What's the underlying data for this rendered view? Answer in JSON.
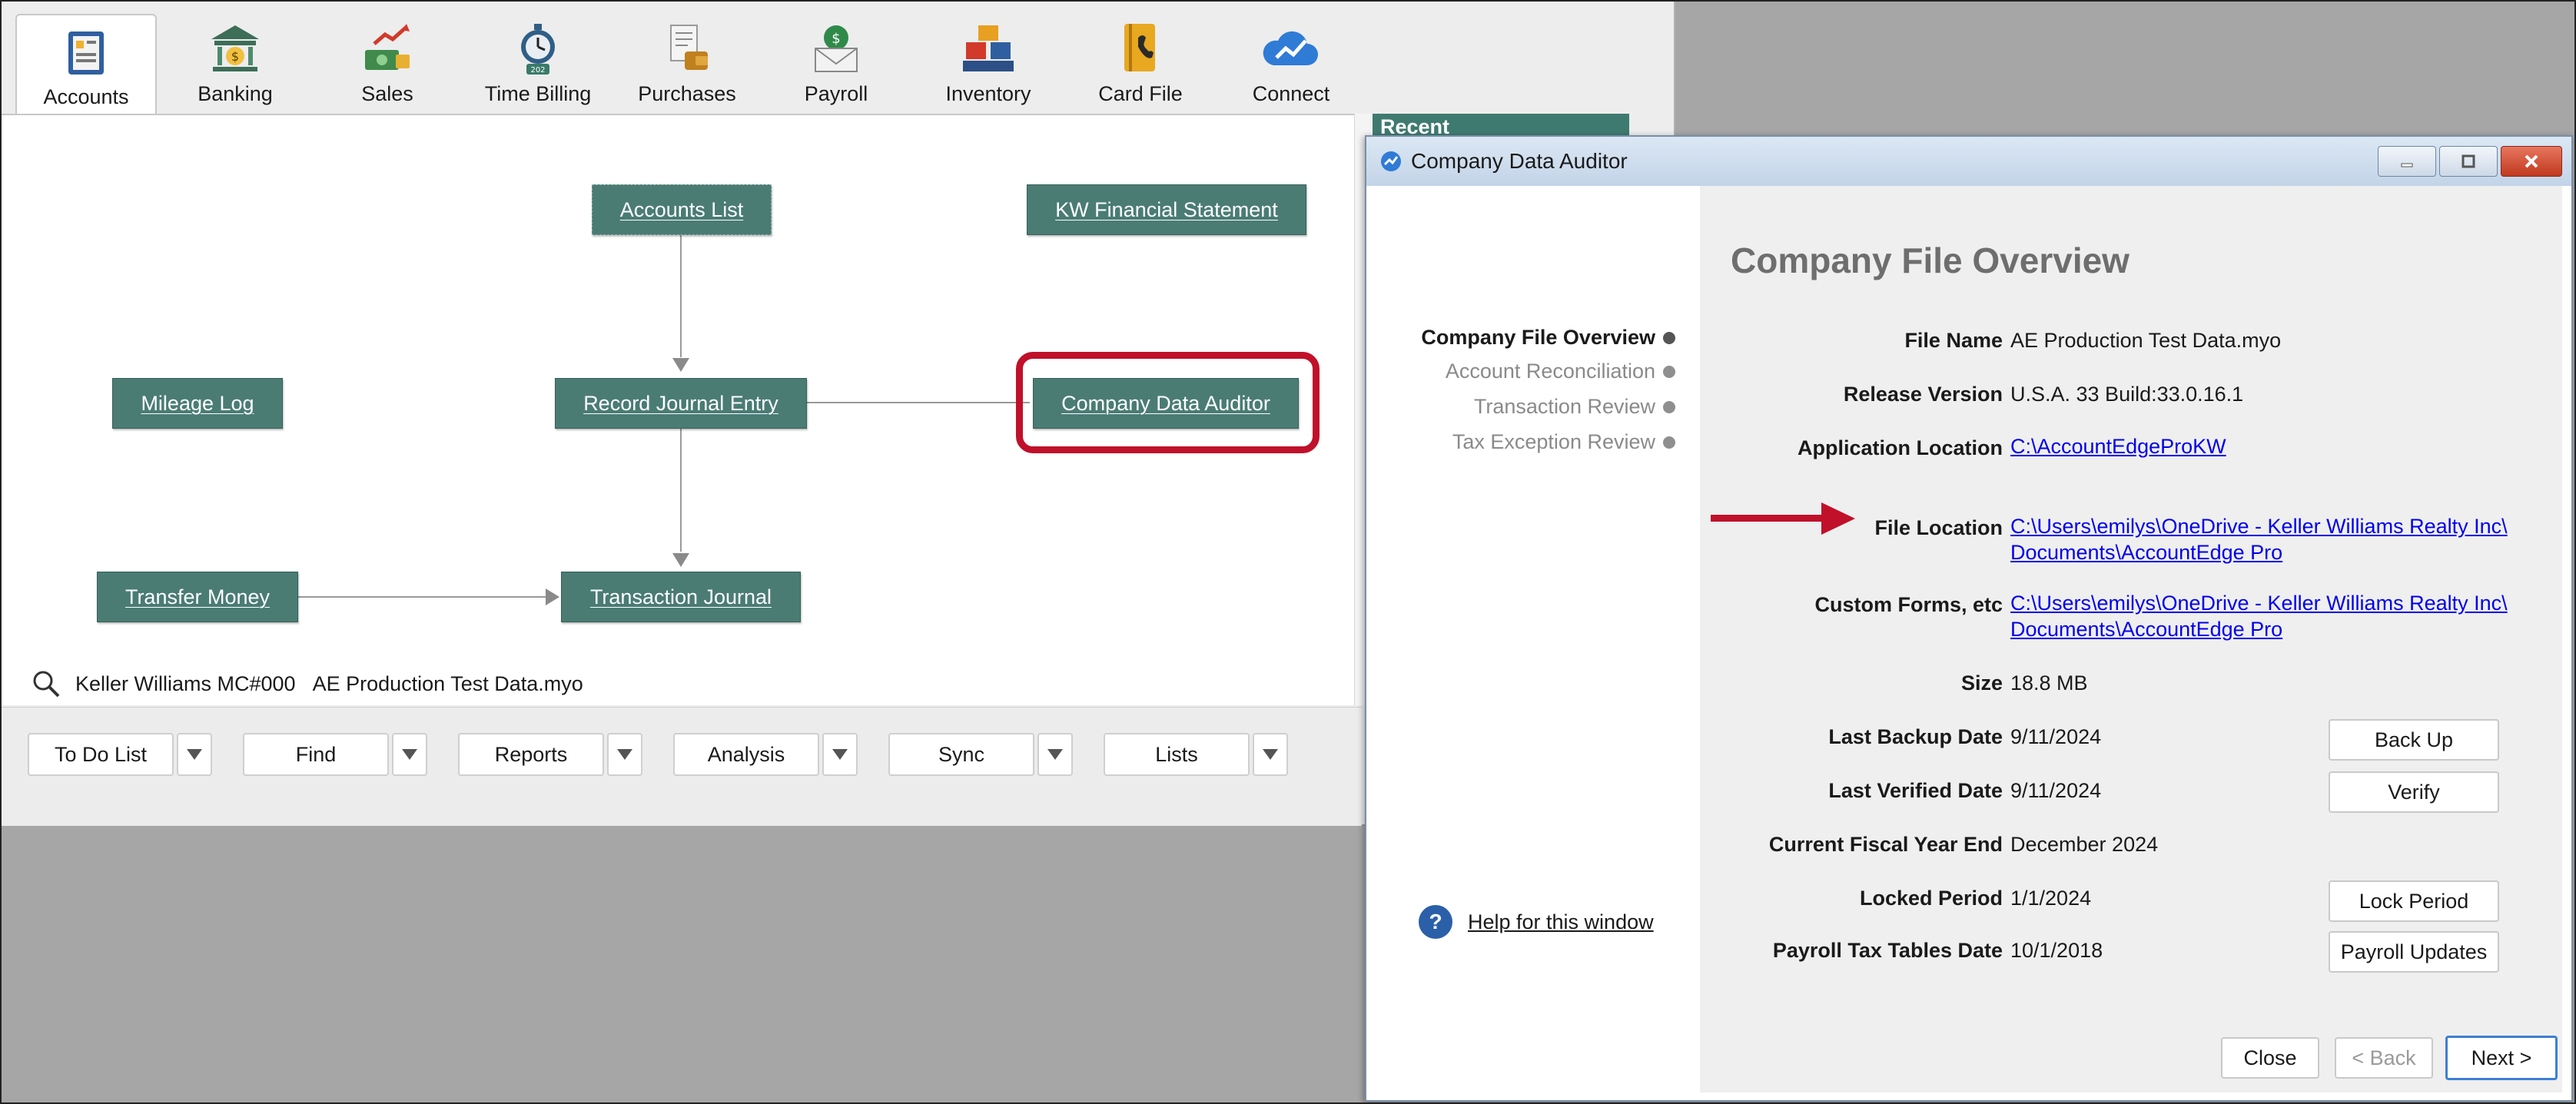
{
  "tabs": [
    {
      "label": "Accounts",
      "icon": "accounts-book-icon",
      "active": true
    },
    {
      "label": "Banking",
      "icon": "bank-icon",
      "active": false
    },
    {
      "label": "Sales",
      "icon": "sales-icon",
      "active": false
    },
    {
      "label": "Time Billing",
      "icon": "stopwatch-icon",
      "active": false
    },
    {
      "label": "Purchases",
      "icon": "purchases-icon",
      "active": false
    },
    {
      "label": "Payroll",
      "icon": "payroll-envelope-icon",
      "active": false
    },
    {
      "label": "Inventory",
      "icon": "inventory-boxes-icon",
      "active": false
    },
    {
      "label": "Card File",
      "icon": "card-file-icon",
      "active": false
    },
    {
      "label": "Connect",
      "icon": "cloud-connect-icon",
      "active": false
    }
  ],
  "flow": {
    "accounts_list": "Accounts List",
    "kw_financial": "KW Financial Statement",
    "mileage_log": "Mileage Log",
    "record_journal": "Record Journal Entry",
    "company_auditor": "Company Data Auditor",
    "transfer_money": "Transfer Money",
    "transaction_journal": "Transaction Journal"
  },
  "status": {
    "company": "Keller Williams MC#000",
    "file": "AE Production Test Data.myo"
  },
  "command_bar": [
    "To Do List",
    "Find",
    "Reports",
    "Analysis",
    "Sync",
    "Lists"
  ],
  "recent_label": "Recent",
  "dialog": {
    "title": "Company Data Auditor",
    "heading": "Company File Overview",
    "steps": [
      {
        "label": "Company File Overview",
        "active": true
      },
      {
        "label": "Account Reconciliation",
        "active": false
      },
      {
        "label": "Transaction Review",
        "active": false
      },
      {
        "label": "Tax Exception Review",
        "active": false
      }
    ],
    "fields": {
      "file_name": {
        "label": "File Name",
        "value": "AE Production Test Data.myo"
      },
      "release_version": {
        "label": "Release Version",
        "value": "U.S.A. 33 Build:33.0.16.1"
      },
      "application_location": {
        "label": "Application Location",
        "value": "C:\\AccountEdgeProKW"
      },
      "file_location": {
        "label": "File Location",
        "line1": "C:\\Users\\emilys\\OneDrive - Keller Williams Realty Inc\\",
        "line2": "Documents\\AccountEdge Pro"
      },
      "custom_forms": {
        "label": "Custom Forms, etc",
        "line1": "C:\\Users\\emilys\\OneDrive - Keller Williams Realty Inc\\",
        "line2": "Documents\\AccountEdge Pro"
      },
      "size": {
        "label": "Size",
        "value": "18.8 MB"
      },
      "last_backup": {
        "label": "Last Backup Date",
        "value": "9/11/2024"
      },
      "last_verified": {
        "label": "Last Verified Date",
        "value": "9/11/2024"
      },
      "fiscal_year_end": {
        "label": "Current Fiscal Year End",
        "value": "December 2024"
      },
      "locked_period": {
        "label": "Locked Period",
        "value": "1/1/2024"
      },
      "payroll_tax": {
        "label": "Payroll Tax Tables Date",
        "value": "10/1/2018"
      }
    },
    "buttons": {
      "back_up": "Back Up",
      "verify": "Verify",
      "lock_period": "Lock Period",
      "payroll_updates": "Payroll Updates",
      "close": "Close",
      "back": "< Back",
      "next": "Next >"
    },
    "help": "Help for this window"
  },
  "colors": {
    "flow_button": "#4a7c74",
    "highlight": "#c0102a",
    "link": "#0000ee",
    "recent_header": "#3f7a70"
  }
}
